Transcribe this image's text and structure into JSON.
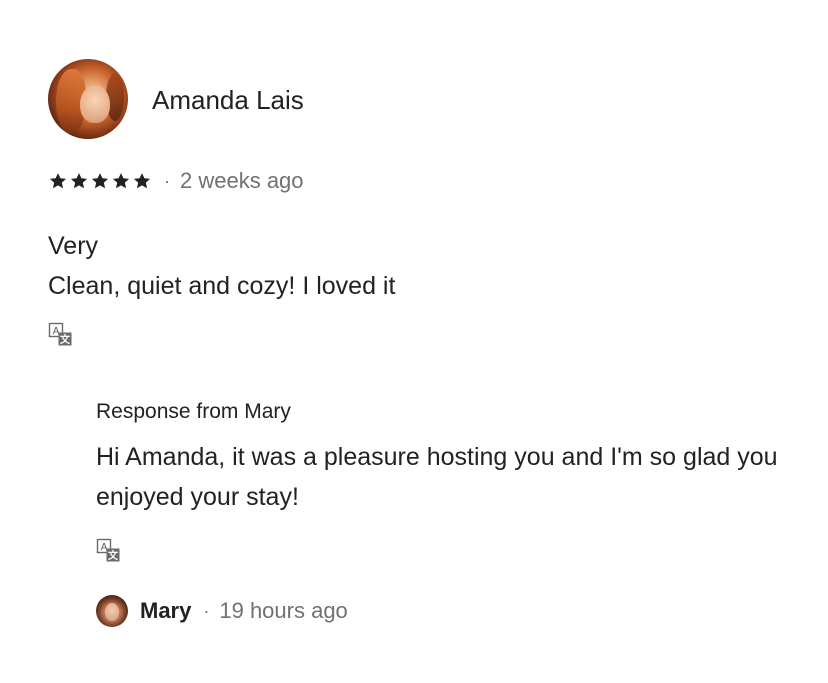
{
  "review": {
    "reviewer_name": "Amanda Lais",
    "rating": 5,
    "rating_max": 5,
    "separator": "·",
    "time_ago": "2 weeks ago",
    "text_line1": "Very",
    "text_line2": "Clean, quiet and cozy! I loved it",
    "translate_icon": "translate-icon"
  },
  "response": {
    "heading": "Response from Mary",
    "text": "Hi Amanda, it was a pleasure hosting you and I'm so glad you enjoyed your stay!",
    "translate_icon": "translate-icon"
  },
  "host": {
    "name": "Mary",
    "separator": "·",
    "time_ago": "19 hours ago"
  },
  "colors": {
    "text_primary": "#222222",
    "text_secondary": "#717171",
    "background": "#ffffff"
  }
}
